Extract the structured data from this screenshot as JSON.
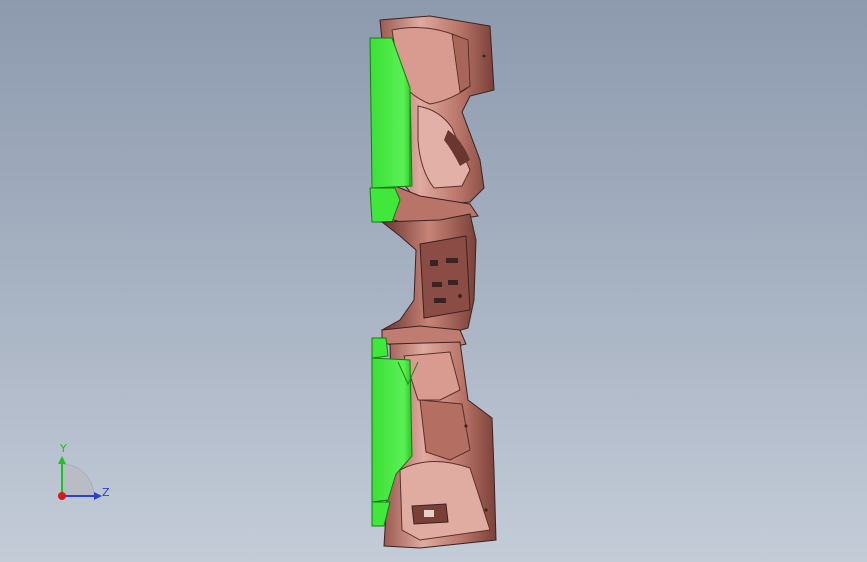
{
  "viewport": {
    "background_top": "#8d9aae",
    "background_bottom": "#c4ccd8"
  },
  "model": {
    "description_icon": "cad-part-3d-model",
    "colors": {
      "part_body": "#c98a80",
      "part_shadow": "#8a4c44",
      "part_edge": "#3a2320",
      "selected_face": "#3fe83a",
      "selected_face_dark": "#1fa01b"
    }
  },
  "triad": {
    "y_label": "Y",
    "z_label": "Z",
    "colors": {
      "y_axis": "#1cc41c",
      "z_axis": "#2a3fd6",
      "x_axis": "#d41c1c"
    }
  }
}
